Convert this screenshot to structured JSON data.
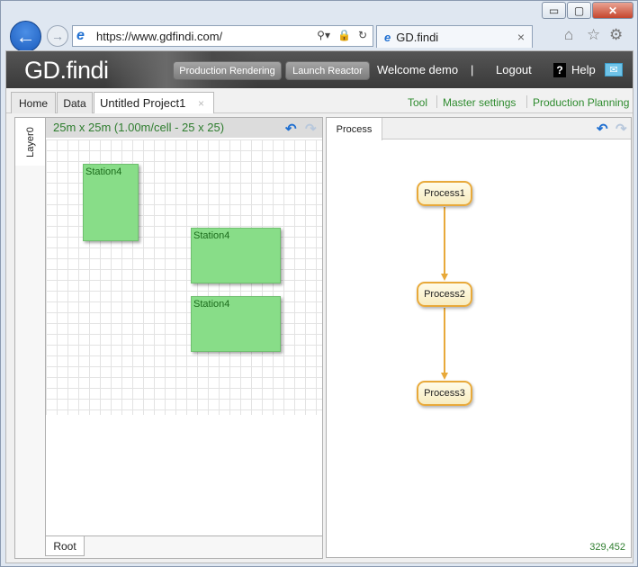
{
  "browser": {
    "url": "https://www.gdfindi.com/",
    "tab_title": "GD.findi",
    "window_buttons": {
      "minimize": "▭",
      "maximize": "▢",
      "close": "✕"
    }
  },
  "header": {
    "logo": "GD.findi",
    "buttons": {
      "production_rendering": "Production Rendering",
      "launch_reactor": "Launch Reactor"
    },
    "welcome": "Welcome demo",
    "separator": "|",
    "logout": "Logout",
    "help_icon": "?",
    "help": "Help"
  },
  "tabs": {
    "home": "Home",
    "data": "Data",
    "project": "Untitled Project1",
    "close": "×"
  },
  "right_links": {
    "tool": "Tool",
    "master_settings": "Master settings",
    "production_planning": "Production Planning"
  },
  "layout_panel": {
    "layer_tab": "Layer0",
    "grid_info": "25m x 25m (1.00m/cell - 25 x 25)",
    "stations": [
      "Station4",
      "Station4",
      "Station4"
    ],
    "root_tab": "Root"
  },
  "process_panel": {
    "tab": "Process",
    "nodes": [
      "Process1",
      "Process2",
      "Process3"
    ],
    "coords": "329,452"
  },
  "colors": {
    "accent_green": "#2e8b2e",
    "station_fill": "#88dd88",
    "process_border": "#e8a93a"
  }
}
